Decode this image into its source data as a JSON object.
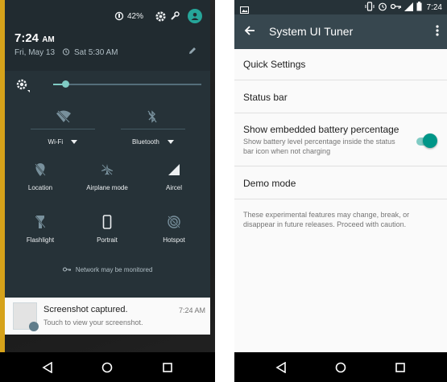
{
  "left": {
    "status": {
      "battery": "42%"
    },
    "clock": {
      "time": "7:24",
      "ampm": "AM"
    },
    "date": "Fri, May 13",
    "alarm": "Sat 5:30 AM",
    "tiles": [
      {
        "label": "Wi-Fi",
        "has_dropdown": true
      },
      {
        "label": "Bluetooth",
        "has_dropdown": true
      },
      {
        "label": "Location"
      },
      {
        "label": "Airplane mode"
      },
      {
        "label": "Aircel"
      },
      {
        "label": "Flashlight"
      },
      {
        "label": "Portrait"
      },
      {
        "label": "Hotspot"
      }
    ],
    "network_notice": "Network may be monitored",
    "brightness_level": 0.08,
    "notification": {
      "title": "Screenshot captured.",
      "text": "Touch to view your screenshot.",
      "time": "7:24 AM"
    }
  },
  "right": {
    "status": {
      "time": "7:24"
    },
    "toolbar": {
      "title": "System UI Tuner"
    },
    "items": [
      {
        "label": "Quick Settings"
      },
      {
        "label": "Status bar"
      },
      {
        "label": "Show embedded battery percentage",
        "sub": "Show battery level percentage inside the status bar icon when not charging",
        "toggle_on": true
      },
      {
        "label": "Demo mode"
      }
    ],
    "footer": "These experimental features may change, break, or disappear in future releases. Proceed with caution."
  },
  "colors": {
    "accent": "#009688",
    "shade": "#263238",
    "toolbar": "#37474f"
  }
}
